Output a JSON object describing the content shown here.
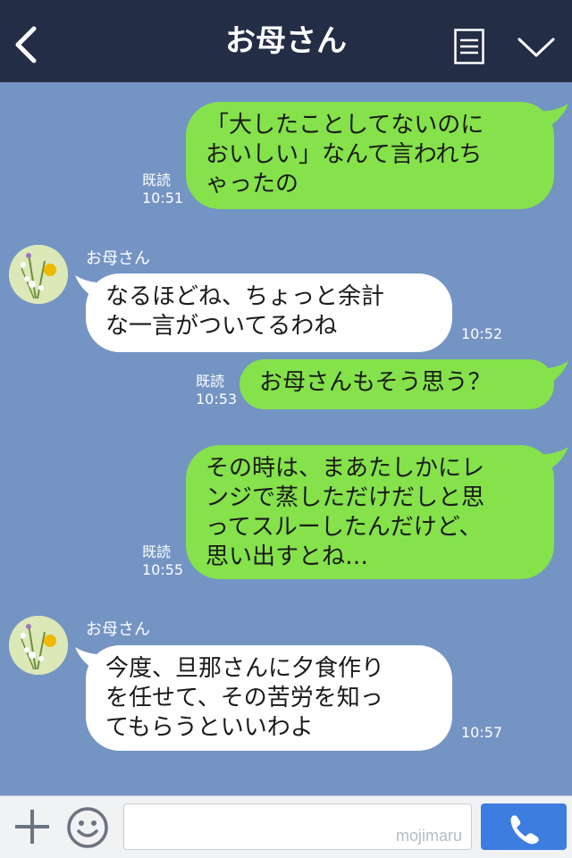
{
  "header": {
    "title": "お母さん",
    "icons": {
      "back": "chevron-left-icon",
      "menu": "document-menu-icon",
      "dropdown": "chevron-down-icon"
    }
  },
  "messages": [
    {
      "side": "out",
      "text": "「大したことしてないのに\nおいしい」なんて言われち\nゃったの",
      "read": "既読",
      "time": "10:51"
    },
    {
      "side": "in",
      "sender": "お母さん",
      "text": "なるほどね、ちょっと余計\nな一言がついてるわね",
      "time": "10:52"
    },
    {
      "side": "out",
      "text": "お母さんもそう思う？",
      "read": "既読",
      "time": "10:53"
    },
    {
      "side": "out",
      "text": "その時は、まあたしかにレ\nンジで蒸しただけだしと思\nってスルーしたんだけど、\n思い出すとね…",
      "read": "既読",
      "time": "10:55"
    },
    {
      "side": "in",
      "sender": "お母さん",
      "text": "今度、旦那さんに夕食作り\nを任せて、その苦労を知っ\nてもらうといいわよ",
      "time": "10:57"
    }
  ],
  "input_bar": {
    "watermark": "mojimaru",
    "icons": {
      "plus": "plus-icon",
      "emoji": "smiley-icon",
      "call": "phone-icon"
    }
  },
  "colors": {
    "header_bg": "#232d45",
    "chat_bg": "#7494c4",
    "outgoing_bubble": "#85e24a",
    "incoming_bubble": "#ffffff",
    "call_button": "#3c7de0"
  }
}
